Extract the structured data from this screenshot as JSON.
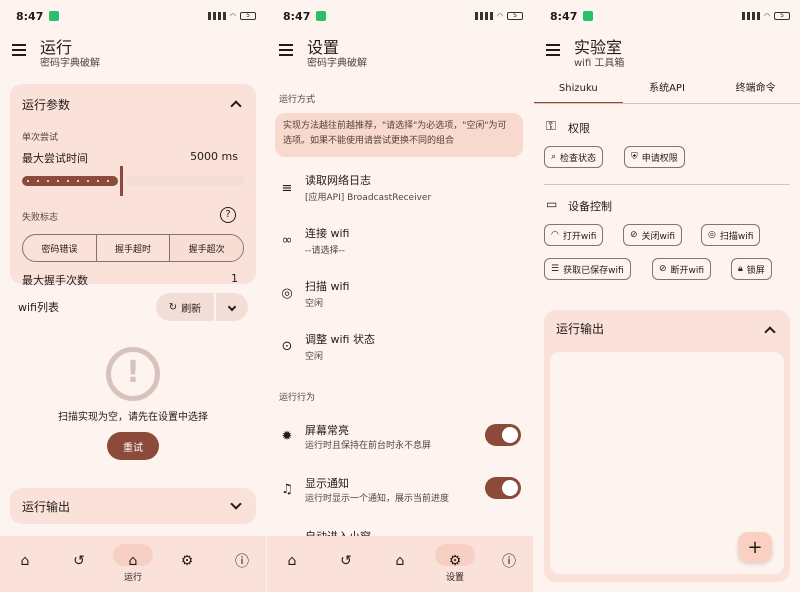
{
  "status": {
    "time": "8:47",
    "battery": "5"
  },
  "run": {
    "title": "运行",
    "subtitle": "密码字典破解",
    "params_card": {
      "title": "运行参数"
    },
    "single_attempt": "单次尝试",
    "max_time_label": "最大尝试时间",
    "max_time_value": "5000 ms",
    "fail_flag": "失败标志",
    "segments": [
      "密码错误",
      "握手超时",
      "握手超次"
    ],
    "max_handshake_label": "最大握手次数",
    "max_handshake_value": "1",
    "wifi_list": "wifi列表",
    "refresh": "刷新",
    "empty_msg": "扫描实现为空，请先在设置中选择",
    "retry": "重试",
    "output_card": "运行输出",
    "nav_active": "运行"
  },
  "settings": {
    "title": "设置",
    "subtitle": "密码字典破解",
    "section_method": "运行方式",
    "info": "实现方法越往前越推荐，\"请选择\"为必选项，\"空闲\"为可选项。如果不能使用请尝试更换不同的组合",
    "rows": [
      {
        "title": "读取网络日志",
        "sub": "[应用API] BroadcastReceiver"
      },
      {
        "title": "连接 wifi",
        "sub": "--请选择--"
      },
      {
        "title": "扫描 wifi",
        "sub": "空闲"
      },
      {
        "title": "调整 wifi 状态",
        "sub": "空闲"
      }
    ],
    "section_behavior": "运行行为",
    "behavior": [
      {
        "title": "屏幕常亮",
        "sub": "运行时且保持在前台时永不息屏"
      },
      {
        "title": "显示通知",
        "sub": "运行时显示一个通知，展示当前进度"
      },
      {
        "title": "自动进入小窗",
        "sub": ""
      }
    ],
    "nav_active": "设置"
  },
  "lab": {
    "title": "实验室",
    "subtitle": "wifi 工具箱",
    "tabs": [
      "Shizuku",
      "系统API",
      "终端命令"
    ],
    "perm_title": "权限",
    "perm_buttons": [
      "检查状态",
      "申请权限"
    ],
    "device_title": "设备控制",
    "device_buttons_row1": [
      "打开wifi",
      "关闭wifi",
      "扫描wifi"
    ],
    "device_buttons_row2": [
      "获取已保存wifi",
      "断开wifi",
      "锁屏"
    ],
    "output_card": "运行输出",
    "fab": "+"
  }
}
